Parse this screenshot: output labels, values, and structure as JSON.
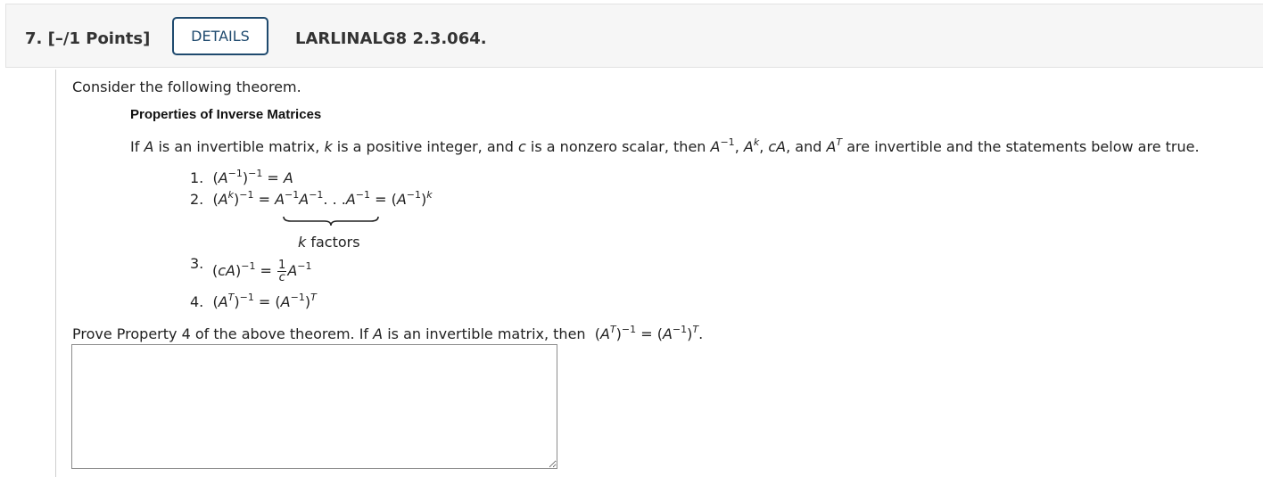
{
  "question": {
    "number": "7.",
    "points": "[–/1 Points]",
    "details_label": "DETAILS",
    "id": "LARLINALG8 2.3.064."
  },
  "prompt": {
    "intro": "Consider the following theorem.",
    "theorem_title": "Properties of Inverse Matrices",
    "statement": {
      "p1": "If ",
      "A": "A",
      "p2": " is an invertible matrix, ",
      "k": "k",
      "p3": " is a positive integer, and ",
      "c": "c",
      "p4": " is a nonzero scalar, then ",
      "m1": "A",
      "m1sup": "−1",
      "comma1": ",  ",
      "m2": "A",
      "m2sup": "k",
      "comma2": ",  ",
      "m3": "cA",
      "p5": ", and ",
      "m4": "A",
      "m4sup": "T",
      "p6": " are invertible and the statements below are true."
    },
    "properties": {
      "n1": "1.",
      "n2": "2.",
      "n3": "3.",
      "n4": "4.",
      "k_factors_k": "k",
      "k_factors_label": " factors"
    },
    "prove": {
      "p1": "Prove Property 4 of the above theorem. If ",
      "A": "A",
      "p2": " is an invertible matrix, then "
    }
  }
}
